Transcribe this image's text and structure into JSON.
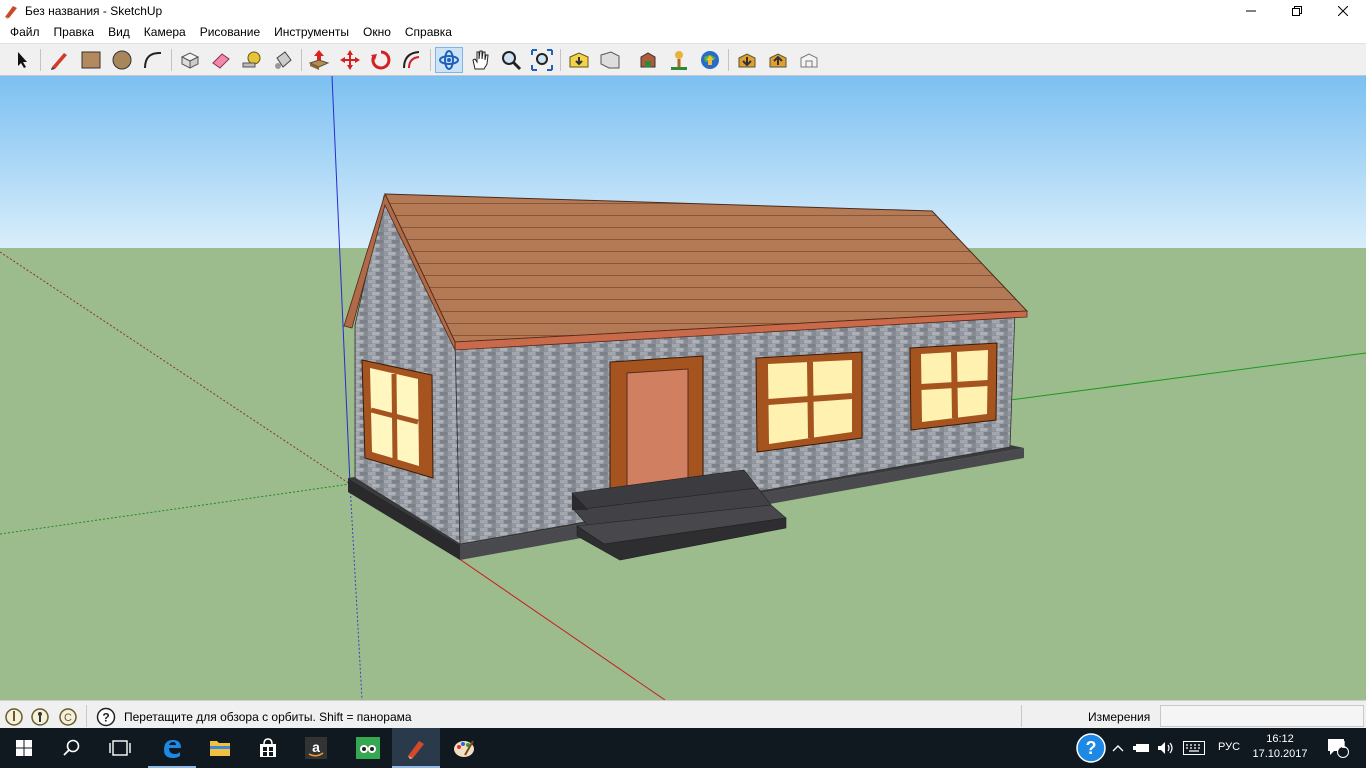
{
  "window": {
    "title": "Без названия - SketchUp",
    "app_icon": "sketchup-icon",
    "controls": [
      "minimize-icon",
      "restore-icon",
      "close-icon"
    ]
  },
  "menu": {
    "items": [
      "Файл",
      "Правка",
      "Вид",
      "Камера",
      "Рисование",
      "Инструменты",
      "Окно",
      "Справка"
    ]
  },
  "toolbar": {
    "tools": [
      {
        "id": "select",
        "icon": "select-arrow-icon"
      },
      {
        "id": "line",
        "icon": "pencil-line-icon"
      },
      {
        "id": "rectangle",
        "icon": "rectangle-icon"
      },
      {
        "id": "circle",
        "icon": "circle-icon"
      },
      {
        "id": "arc",
        "icon": "arc-icon"
      },
      {
        "id": "make-component",
        "icon": "make-component-icon"
      },
      {
        "id": "eraser",
        "icon": "eraser-icon"
      },
      {
        "id": "tape-measure",
        "icon": "tape-measure-icon"
      },
      {
        "id": "paint-bucket",
        "icon": "paint-bucket-icon"
      },
      {
        "id": "push-pull",
        "icon": "push-pull-icon"
      },
      {
        "id": "move",
        "icon": "move-icon"
      },
      {
        "id": "rotate",
        "icon": "rotate-icon"
      },
      {
        "id": "offset",
        "icon": "offset-icon"
      },
      {
        "id": "orbit",
        "icon": "orbit-icon"
      },
      {
        "id": "pan",
        "icon": "pan-hand-icon"
      },
      {
        "id": "zoom",
        "icon": "zoom-icon"
      },
      {
        "id": "zoom-extents",
        "icon": "zoom-extents-icon"
      },
      {
        "id": "warehouse",
        "icon": "3d-warehouse-icon"
      },
      {
        "id": "share-model",
        "icon": "share-model-icon"
      },
      {
        "id": "get-models",
        "icon": "get-models-icon"
      },
      {
        "id": "geo-location",
        "icon": "geo-location-icon"
      },
      {
        "id": "google-earth",
        "icon": "google-earth-icon"
      },
      {
        "id": "extension-warehouse",
        "icon": "extension-warehouse-icon"
      },
      {
        "id": "upload-extension",
        "icon": "upload-extension-icon"
      },
      {
        "id": "components",
        "icon": "components-icon"
      }
    ],
    "active_tool": "orbit"
  },
  "viewport": {
    "sky_color": "#86c7f4",
    "ground_color": "#9cbc8e",
    "axis_colors": {
      "red": "#c81e1e",
      "green": "#2aa02a",
      "blue": "#2020c8"
    }
  },
  "statusbar": {
    "icons": [
      "geo-location-status-icon",
      "credits-status-icon",
      "user-status-icon"
    ],
    "help_icon": "help-question-icon",
    "hint": "Перетащите для обзора с орбиты.  Shift = панорама",
    "measurements_label": "Измерения",
    "measurements_value": ""
  },
  "taskbar": {
    "apps": [
      {
        "id": "start",
        "icon": "windows-start-icon"
      },
      {
        "id": "search",
        "icon": "search-icon"
      },
      {
        "id": "task-view",
        "icon": "task-view-icon"
      },
      {
        "id": "edge",
        "icon": "edge-browser-icon"
      },
      {
        "id": "explorer",
        "icon": "file-explorer-icon"
      },
      {
        "id": "store",
        "icon": "store-icon"
      },
      {
        "id": "amazon",
        "icon": "amazon-icon"
      },
      {
        "id": "tripadvisor",
        "icon": "tripadvisor-icon"
      },
      {
        "id": "sketchup",
        "icon": "sketchup-taskbar-icon"
      },
      {
        "id": "paint",
        "icon": "paint-icon"
      }
    ],
    "tray": {
      "help_icon": "help-circle-icon",
      "icons": [
        "chevron-up-icon",
        "battery-icon",
        "volume-icon",
        "keyboard-icon"
      ],
      "language": "РУС",
      "time": "16:12",
      "date": "17.10.2017",
      "notification_icon": "notifications-icon",
      "notification_count": "1"
    }
  }
}
